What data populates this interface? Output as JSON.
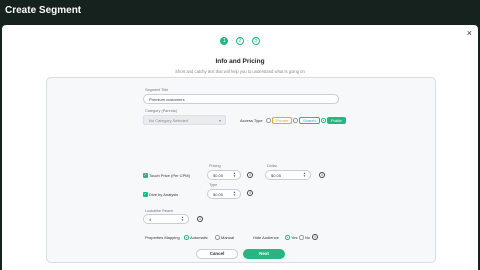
{
  "window": {
    "title": "Create Segment"
  },
  "modal": {
    "close_glyph": "×"
  },
  "stepper": {
    "steps": [
      "1",
      "2",
      "3"
    ],
    "separator": "-",
    "active_index": 0
  },
  "header": {
    "title": "Info and Pricing",
    "subtitle": "Short and catchy text that will help you to understand what is going on"
  },
  "form": {
    "segment_title": {
      "label": "Segment Title",
      "value": "Premium customers"
    },
    "category": {
      "label": "Category (Parents)",
      "value": "No Category Selected"
    },
    "access_type": {
      "label": "Access Type",
      "options": [
        "Private",
        "Shared",
        "Public"
      ],
      "selected": "Public"
    },
    "touch_price": {
      "checkbox_label": "Touch Price (Per CPM)",
      "field_label": "Pricing",
      "value": "$0.05"
    },
    "dollar": {
      "field_label": "Dollar",
      "value": "$0.05"
    },
    "dive_analysis": {
      "checkbox_label": "Dive by Analysis",
      "field_label": "Type",
      "value": "$0.05"
    },
    "lookalike": {
      "field_label": "Lookalike Reach",
      "value": "4"
    },
    "property_mapping": {
      "label": "Properties Mapping",
      "options": [
        "Automatic",
        "Manual"
      ],
      "selected": "Automatic"
    },
    "hide_audience": {
      "label": "Hide Audience",
      "options": [
        "Yes",
        "No"
      ],
      "selected": "Yes"
    }
  },
  "footer": {
    "cancel_label": "Cancel",
    "next_label": "Next"
  },
  "colors": {
    "accent": "#25b781",
    "topbar": "#15221d",
    "private": "#f0a030",
    "shared": "#3aa0e0"
  },
  "icons": {
    "info": "info-icon",
    "chevron": "chevron-down-icon",
    "spinner": "spinner-arrows-icon",
    "check": "check-icon",
    "close": "close-icon"
  }
}
